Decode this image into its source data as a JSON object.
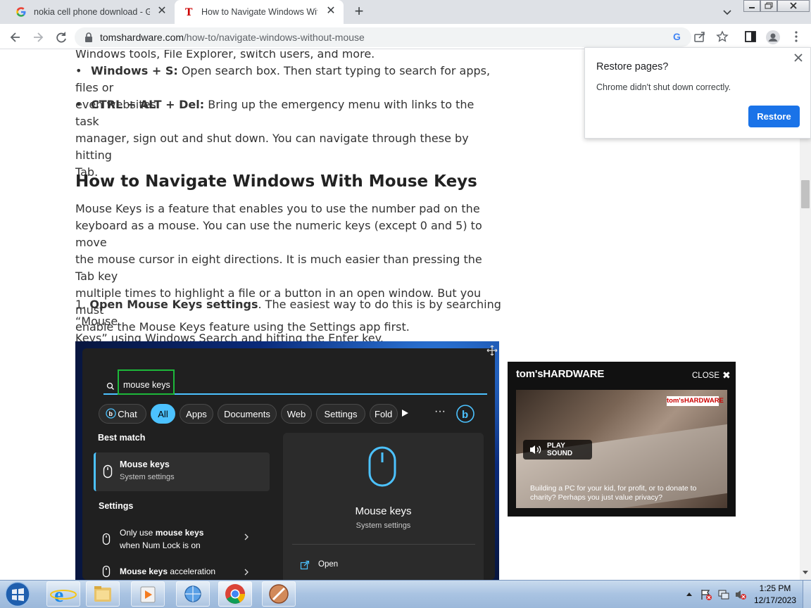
{
  "browser": {
    "tabs": [
      {
        "title": "nokia cell phone download - Goo",
        "icon": "google-favicon",
        "active": false
      },
      {
        "title": "How to Navigate Windows Witho",
        "icon": "toms-hardware-favicon",
        "active": true
      }
    ],
    "url_host": "tomshardware.com",
    "url_path": "/how-to/navigate-windows-without-mouse"
  },
  "article": {
    "lead_fragment": "Windows tools, File Explorer, switch users, and more.",
    "bullets": [
      {
        "key": "Windows + S:",
        "text_line1": " Open search box. Then start typing to search for apps, files or",
        "text_line2": "even websites."
      },
      {
        "key": "CTRL + ALT + Del:",
        "text_line1": " Bring up the emergency menu with links to the task",
        "text_line2": "manager, sign out and shut down. You can navigate through these by hitting",
        "text_line3": "Tab."
      }
    ],
    "heading": "How to Navigate Windows With Mouse Keys",
    "paragraph_lines": [
      "Mouse Keys is a feature that enables you to use the number pad on the",
      "keyboard as a mouse. You can use the numeric keys (except 0 and 5) to move",
      "the mouse cursor in eight directions. It is much easier than pressing the Tab key",
      "multiple times to highlight a file or a button in an open window. But you must",
      "enable the Mouse Keys feature using the Settings app first."
    ],
    "step_prefix": "1. ",
    "step_bold": "Open Mouse Keys settings",
    "step_line1_rest": ". The easiest way to do this is by searching “Mouse",
    "step_line2": "Keys” using Windows Search and hitting the Enter key."
  },
  "screenshot": {
    "search_value": "mouse keys",
    "chips": [
      "Chat",
      "All",
      "Apps",
      "Documents",
      "Web",
      "Settings",
      "Fold"
    ],
    "best_match_label": "Best match",
    "best_match_title": "Mouse keys",
    "best_match_sub": "System settings",
    "settings_label": "Settings",
    "setting1_pre": "Only use ",
    "setting1_bold": "mouse keys",
    "setting1_line2": "when Num Lock is on",
    "setting2_bold": "Mouse keys",
    "setting2_rest": " acceleration",
    "preview_title": "Mouse keys",
    "preview_sub": "System settings",
    "open_label": "Open"
  },
  "popup": {
    "title": "Restore pages?",
    "message": "Chrome didn't shut down correctly.",
    "button": "Restore"
  },
  "ad": {
    "logo": "tom'sHARDWARE",
    "close_label": "CLOSE",
    "badge": "tom'sHARDWARE",
    "play_sound": "PLAY SOUND",
    "caption_line1": "Building a PC for your kid, for profit, or to donate to",
    "caption_line2": "charity? Perhaps you just value privacy?"
  },
  "taskbar": {
    "time": "1:25 PM",
    "date": "12/17/2023"
  }
}
